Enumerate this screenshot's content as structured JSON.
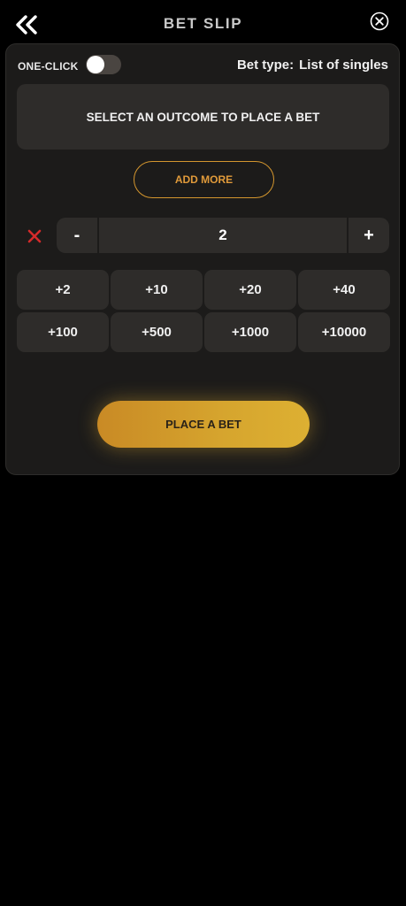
{
  "header": {
    "back_icon": "double-chevron-left-icon",
    "title": "BET SLIP",
    "close_icon": "close-circle-icon"
  },
  "options": {
    "one_click_label": "ONE-CLICK",
    "one_click_enabled": false,
    "bet_type_label": "Bet type:",
    "bet_type_value": "List of singles"
  },
  "outcome": {
    "message": "SELECT AN OUTCOME TO PLACE A BET"
  },
  "add_more_label": "ADD MORE",
  "stake": {
    "clear_icon": "x-icon",
    "minus_label": "-",
    "value": "2",
    "plus_label": "+"
  },
  "quick_amounts": [
    "+2",
    "+10",
    "+20",
    "+40",
    "+100",
    "+500",
    "+1000",
    "+10000"
  ],
  "place_bet_label": "PLACE A BET",
  "colors": {
    "accent": "#d4962e",
    "clear_red": "#d42a2a",
    "panel": "#1c1b1a",
    "button_bg": "#2e2c2a"
  }
}
